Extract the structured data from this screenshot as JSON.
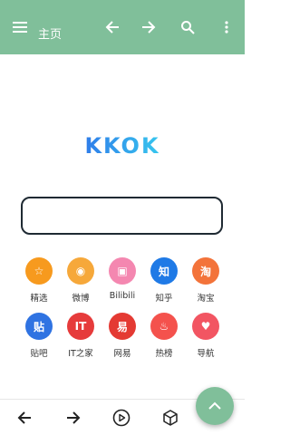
{
  "toolbar": {
    "title": "主页",
    "icons": [
      "menu-icon",
      "arrow-left-icon",
      "arrow-right-icon",
      "search-icon",
      "more-vert-icon"
    ]
  },
  "logo": {
    "text": "KKOK"
  },
  "search": {
    "value": ""
  },
  "sites": [
    {
      "label": "精选",
      "glyph": "☆",
      "color": "#f79a1e"
    },
    {
      "label": "微博",
      "glyph": "◉",
      "color": "#f6a83a"
    },
    {
      "label": "Bilibili",
      "glyph": "▣",
      "color": "#f487b0"
    },
    {
      "label": "知乎",
      "glyph": "知",
      "color": "#1f7ae6"
    },
    {
      "label": "淘宝",
      "glyph": "淘",
      "color": "#f3733a"
    },
    {
      "label": "贴吧",
      "glyph": "贴",
      "color": "#2f73e2"
    },
    {
      "label": "IT之家",
      "glyph": "IT",
      "color": "#e63b3b"
    },
    {
      "label": "网易",
      "glyph": "易",
      "color": "#e43a33"
    },
    {
      "label": "热榜",
      "glyph": "♨",
      "color": "#f4524d"
    },
    {
      "label": "导航",
      "glyph": "♥",
      "color": "#f25562"
    }
  ],
  "bottom": {
    "icons": [
      "back-icon",
      "forward-icon",
      "play-circle-icon",
      "box-3d-icon"
    ]
  },
  "colors": {
    "accent": "#80bf9a",
    "logo_start": "#2f7dea",
    "logo_end": "#37c6ee"
  }
}
